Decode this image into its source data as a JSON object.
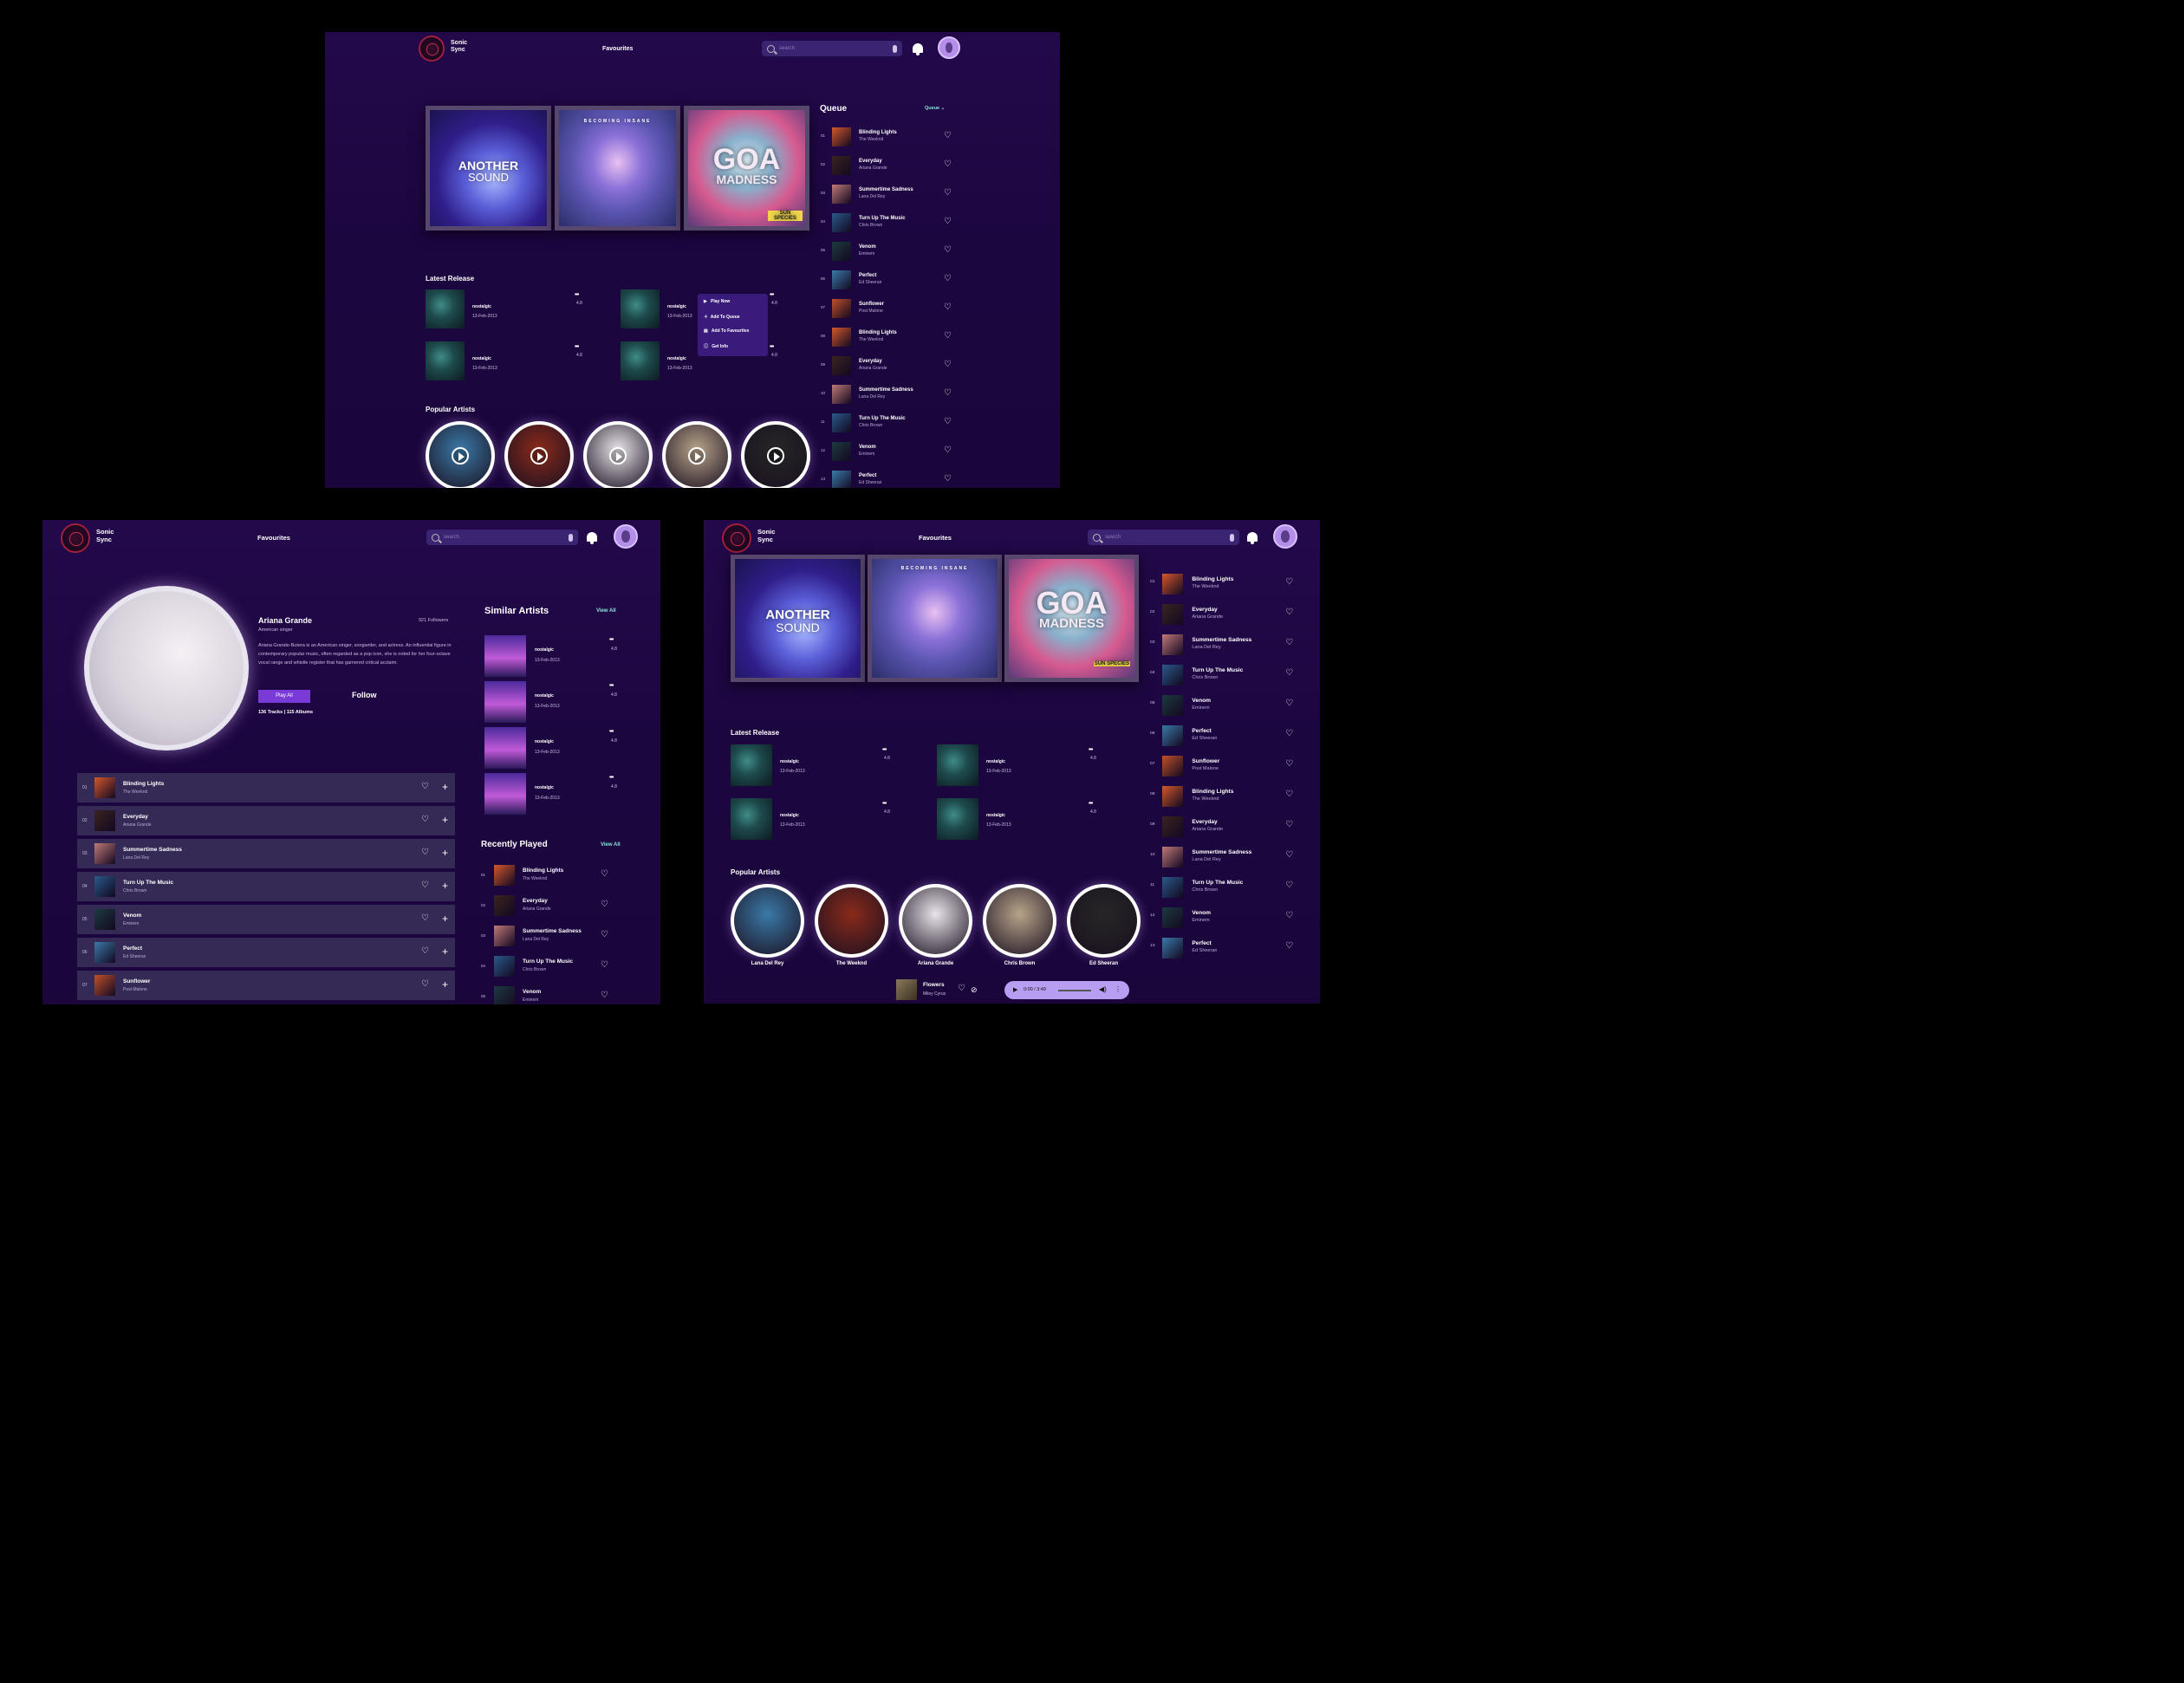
{
  "app": {
    "name_line1": "Sonic",
    "name_line2": "Sync",
    "nav_label": "Favourites",
    "search_placeholder": "search"
  },
  "covers": [
    {
      "line1": "ANOTHER",
      "line2": "SOUND",
      "style": "cv1"
    },
    {
      "line1": "BECOMING INSANE",
      "line2": "",
      "style": "cv2"
    },
    {
      "line1": "GOA",
      "line2": "MADNESS",
      "style": "cv3",
      "sub": "SUN SPECIES"
    }
  ],
  "queue": {
    "title": "Queue",
    "dropdown": "Queue"
  },
  "tracks": [
    {
      "num": "01",
      "title": "Blinding Lights",
      "artist": "The Weeknd",
      "color": "#d2582b"
    },
    {
      "num": "02",
      "title": "Everyday",
      "artist": "Ariana Grande",
      "color": "#3a2420"
    },
    {
      "num": "03",
      "title": "Summertime Sadness",
      "artist": "Lana Del Rey",
      "color": "#c07a78"
    },
    {
      "num": "04",
      "title": "Turn Up The Music",
      "artist": "Chris Brown",
      "color": "#2a5a8a"
    },
    {
      "num": "05",
      "title": "Venom",
      "artist": "Eminem",
      "color": "#1e3a40"
    },
    {
      "num": "06",
      "title": "Perfect",
      "artist": "Ed Sheeran",
      "color": "#3a7aa8"
    },
    {
      "num": "07",
      "title": "Sunflower",
      "artist": "Post Malone",
      "color": "#c0502a"
    },
    {
      "num": "08",
      "title": "Blinding Lights",
      "artist": "The Weeknd",
      "color": "#d2582b"
    },
    {
      "num": "09",
      "title": "Everyday",
      "artist": "Ariana Grande",
      "color": "#3a2420"
    },
    {
      "num": "10",
      "title": "Summertime Sadness",
      "artist": "Lana Del Rey",
      "color": "#c07a78"
    },
    {
      "num": "11",
      "title": "Turn Up The Music",
      "artist": "Chris Brown",
      "color": "#2a5a8a"
    },
    {
      "num": "12",
      "title": "Venom",
      "artist": "Eminem",
      "color": "#1e3a40"
    },
    {
      "num": "13",
      "title": "Perfect",
      "artist": "Ed Sheeran",
      "color": "#3a7aa8"
    }
  ],
  "latest": {
    "title": "Latest Release",
    "item_title": "nostalgic",
    "item_date": "13-Feb-2013",
    "item_rating": "4.8",
    "dots": "•••"
  },
  "context_menu": {
    "play": "Play Now",
    "queue": "Add To Queue",
    "fav": "Add To Favourites",
    "info": "Get Info"
  },
  "popular": {
    "title": "Popular Artists",
    "names": [
      "Lana Del Rey",
      "The Weeknd",
      "Ariana Grande",
      "Chris Brown",
      "Ed Sheeran"
    ],
    "colors": [
      "#3a7aa8",
      "#8a2a1a",
      "#e8e4ea",
      "#b8a48a",
      "#262626"
    ]
  },
  "profile": {
    "name": "Ariana Grande",
    "followers": "921 Followers",
    "role": "American singer",
    "bio": "Ariana Grande-Butera is an American singer, songwriter, and actress. An influential figure in contemporary popular music, often regarded as a pop icon, she is noted for her four-octave vocal range and whistle register that has garnered critical acclaim.",
    "play_all": "Play All",
    "follow": "Follow",
    "stats": "136 Tracks | 115 Albums"
  },
  "similar": {
    "title": "Similar Artists",
    "view_all": "View All"
  },
  "recent": {
    "title": "Recently Played",
    "view_all": "View All"
  },
  "player": {
    "title": "Flowers",
    "artist": "Miley Cyrus",
    "time": "0:00 / 3:49",
    "progress": 0.0
  }
}
